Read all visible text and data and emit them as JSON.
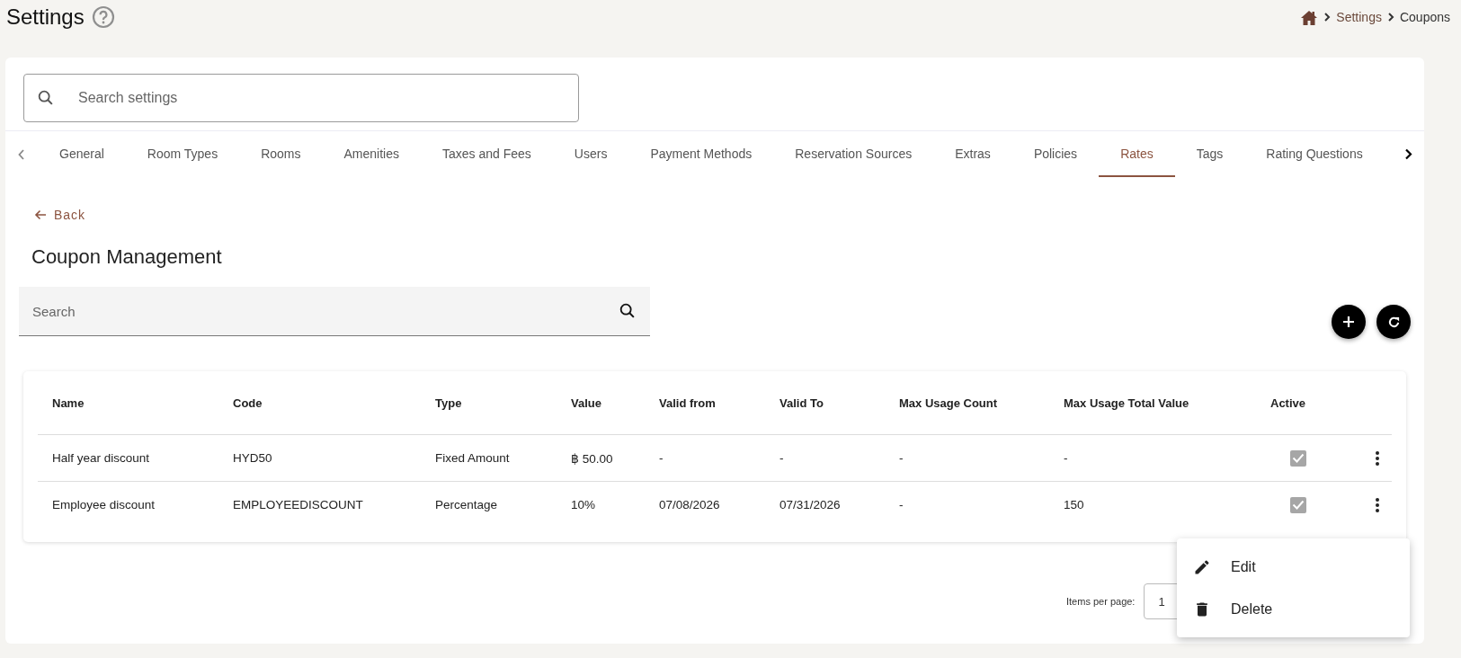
{
  "header": {
    "title": "Settings",
    "breadcrumb": [
      "Settings",
      "Coupons"
    ]
  },
  "settings_search": {
    "placeholder": "Search settings"
  },
  "tabs": [
    {
      "label": "General",
      "selected": false
    },
    {
      "label": "Room Types",
      "selected": false
    },
    {
      "label": "Rooms",
      "selected": false
    },
    {
      "label": "Amenities",
      "selected": false
    },
    {
      "label": "Taxes and Fees",
      "selected": false
    },
    {
      "label": "Users",
      "selected": false
    },
    {
      "label": "Payment Methods",
      "selected": false
    },
    {
      "label": "Reservation Sources",
      "selected": false
    },
    {
      "label": "Extras",
      "selected": false
    },
    {
      "label": "Policies",
      "selected": false
    },
    {
      "label": "Rates",
      "selected": true
    },
    {
      "label": "Tags",
      "selected": false
    },
    {
      "label": "Rating Questions",
      "selected": false
    }
  ],
  "back_link": "Back",
  "page_title": "Coupon Management",
  "search": {
    "placeholder": "Search"
  },
  "table": {
    "columns": [
      "Name",
      "Code",
      "Type",
      "Value",
      "Valid from",
      "Valid To",
      "Max Usage Count",
      "Max Usage Total Value",
      "Active"
    ],
    "rows": [
      {
        "cells": [
          "Half year discount",
          "HYD50",
          "Fixed Amount",
          "฿ 50.00",
          "-",
          "-",
          "-",
          "-"
        ],
        "active": true
      },
      {
        "cells": [
          "Employee discount",
          "EMPLOYEEDISCOUNT",
          "Percentage",
          "10%",
          "07/08/2026",
          "07/31/2026",
          "-",
          "150"
        ],
        "active": true
      }
    ]
  },
  "pagination": {
    "label": "Items per page:",
    "value": "1"
  },
  "context_menu": [
    {
      "kind": "pencil",
      "label": "Edit"
    },
    {
      "kind": "trash",
      "label": "Delete"
    }
  ]
}
